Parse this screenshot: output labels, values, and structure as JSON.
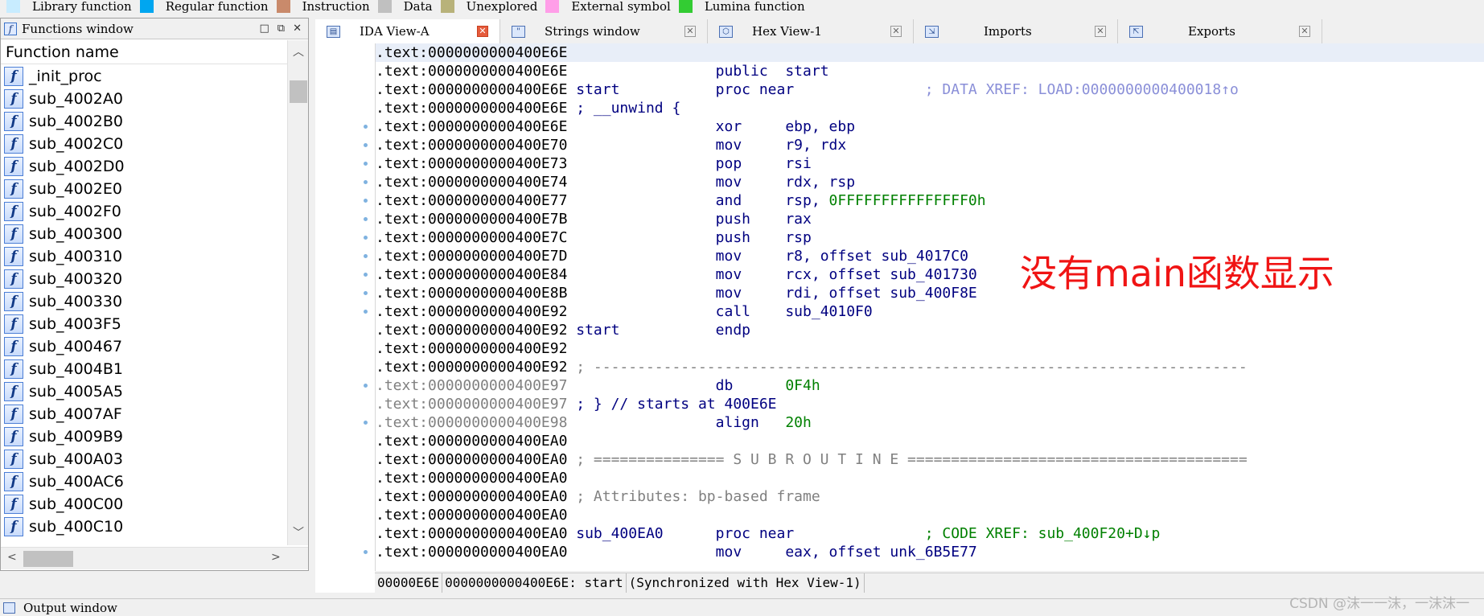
{
  "legend": [
    {
      "label": "Library function",
      "color": "#c8ecff"
    },
    {
      "label": "Regular function",
      "color": "#00a6f0"
    },
    {
      "label": "Instruction",
      "color": "#c98a6b"
    },
    {
      "label": "Data",
      "color": "#c0c0c0"
    },
    {
      "label": "Unexplored",
      "color": "#b8b27a"
    },
    {
      "label": "External symbol",
      "color": "#ff9ee8"
    },
    {
      "label": "Lumina function",
      "color": "#33cc33"
    }
  ],
  "functions_window": {
    "title": "Functions window",
    "column_header": "Function name",
    "items": [
      "_init_proc",
      "sub_4002A0",
      "sub_4002B0",
      "sub_4002C0",
      "sub_4002D0",
      "sub_4002E0",
      "sub_4002F0",
      "sub_400300",
      "sub_400310",
      "sub_400320",
      "sub_400330",
      "sub_4003F5",
      "sub_400467",
      "sub_4004B1",
      "sub_4005A5",
      "sub_4007AF",
      "sub_4009B9",
      "sub_400A03",
      "sub_400AC6",
      "sub_400C00",
      "sub_400C10"
    ]
  },
  "tabs": [
    {
      "label": "IDA View-A",
      "active": true,
      "icon": "ida-view-icon"
    },
    {
      "label": "Strings window",
      "active": false,
      "icon": "strings-icon"
    },
    {
      "label": "Hex View-1",
      "active": false,
      "icon": "hex-icon"
    },
    {
      "label": "Imports",
      "active": false,
      "icon": "imports-icon"
    },
    {
      "label": "Exports",
      "active": false,
      "icon": "exports-icon"
    }
  ],
  "disasm": [
    {
      "addr": ".text:0000000000400E6E",
      "label": "",
      "op": "",
      "args": "",
      "comment": "",
      "dot": false,
      "highlight": true
    },
    {
      "addr": ".text:0000000000400E6E",
      "label": "",
      "op": "public",
      "args": "start",
      "comment": "",
      "dot": false
    },
    {
      "addr": ".text:0000000000400E6E",
      "label": "start",
      "op": "proc near",
      "args": "",
      "comment": "; DATA XREF: LOAD:0000000000400018↑o",
      "dot": false
    },
    {
      "addr": ".text:0000000000400E6E",
      "label": "; __unwind {",
      "op": "",
      "args": "",
      "comment": "",
      "dot": false
    },
    {
      "addr": ".text:0000000000400E6E",
      "label": "",
      "op": "xor",
      "args": "ebp, ebp",
      "comment": "",
      "dot": true
    },
    {
      "addr": ".text:0000000000400E70",
      "label": "",
      "op": "mov",
      "args": "r9, rdx",
      "comment": "",
      "dot": true
    },
    {
      "addr": ".text:0000000000400E73",
      "label": "",
      "op": "pop",
      "args": "rsi",
      "comment": "",
      "dot": true
    },
    {
      "addr": ".text:0000000000400E74",
      "label": "",
      "op": "mov",
      "args": "rdx, rsp",
      "comment": "",
      "dot": true
    },
    {
      "addr": ".text:0000000000400E77",
      "label": "",
      "op": "and",
      "args": "rsp, ",
      "num": "0FFFFFFFFFFFFFFF0h",
      "comment": "",
      "dot": true
    },
    {
      "addr": ".text:0000000000400E7B",
      "label": "",
      "op": "push",
      "args": "rax",
      "comment": "",
      "dot": true
    },
    {
      "addr": ".text:0000000000400E7C",
      "label": "",
      "op": "push",
      "args": "rsp",
      "comment": "",
      "dot": true
    },
    {
      "addr": ".text:0000000000400E7D",
      "label": "",
      "op": "mov",
      "args": "r8, offset sub_4017C0",
      "comment": "",
      "dot": true
    },
    {
      "addr": ".text:0000000000400E84",
      "label": "",
      "op": "mov",
      "args": "rcx, offset sub_401730",
      "comment": "",
      "dot": true
    },
    {
      "addr": ".text:0000000000400E8B",
      "label": "",
      "op": "mov",
      "args": "rdi, offset sub_400F8E",
      "comment": "",
      "dot": true
    },
    {
      "addr": ".text:0000000000400E92",
      "label": "",
      "op": "call",
      "args": "sub_4010F0",
      "comment": "",
      "dot": true
    },
    {
      "addr": ".text:0000000000400E92",
      "label": "start",
      "op": "endp",
      "args": "",
      "comment": "",
      "dot": false
    },
    {
      "addr": ".text:0000000000400E92",
      "label": "",
      "op": "",
      "args": "",
      "comment": "",
      "dot": false
    },
    {
      "addr": ".text:0000000000400E92",
      "label": "; ---------------------------------------------------------------------------",
      "op": "",
      "args": "",
      "comment": "",
      "dot": false,
      "sep": true
    },
    {
      "addr": ".text:0000000000400E97",
      "label": "",
      "op": "db",
      "args": "",
      "num": "0F4h",
      "comment": "",
      "dot": true,
      "grayaddr": true
    },
    {
      "addr": ".text:0000000000400E97",
      "label": "; } // starts at 400E6E",
      "op": "",
      "args": "",
      "comment": "",
      "dot": false,
      "grayaddr": true
    },
    {
      "addr": ".text:0000000000400E98",
      "label": "",
      "op": "align",
      "args": "",
      "num": "20h",
      "comment": "",
      "dot": true,
      "grayaddr": true
    },
    {
      "addr": ".text:0000000000400EA0",
      "label": "",
      "op": "",
      "args": "",
      "comment": "",
      "dot": false
    },
    {
      "addr": ".text:0000000000400EA0",
      "label": "; =============== S U B R O U T I N E =======================================",
      "op": "",
      "args": "",
      "comment": "",
      "dot": false,
      "sep": true
    },
    {
      "addr": ".text:0000000000400EA0",
      "label": "",
      "op": "",
      "args": "",
      "comment": "",
      "dot": false
    },
    {
      "addr": ".text:0000000000400EA0",
      "label": "; Attributes: bp-based frame",
      "op": "",
      "args": "",
      "comment": "",
      "dot": false,
      "sep": true
    },
    {
      "addr": ".text:0000000000400EA0",
      "label": "",
      "op": "",
      "args": "",
      "comment": "",
      "dot": false
    },
    {
      "addr": ".text:0000000000400EA0",
      "label": "sub_400EA0",
      "op": "proc near",
      "args": "",
      "comment": "; CODE XREF: sub_400F20+D↓p",
      "comment_green": true,
      "dot": false
    },
    {
      "addr": ".text:0000000000400EA0",
      "label": "",
      "op": "mov",
      "args": "eax, offset unk_6B5E77",
      "comment": "",
      "dot": true
    }
  ],
  "annotation": "没有main函数显示",
  "status": {
    "offset": "00000E6E",
    "location": "0000000000400E6E: start",
    "sync": "(Synchronized with Hex View-1)"
  },
  "output_window": {
    "title": "Output window"
  },
  "watermark": "CSDN @沫一一沫，一沫沫一"
}
